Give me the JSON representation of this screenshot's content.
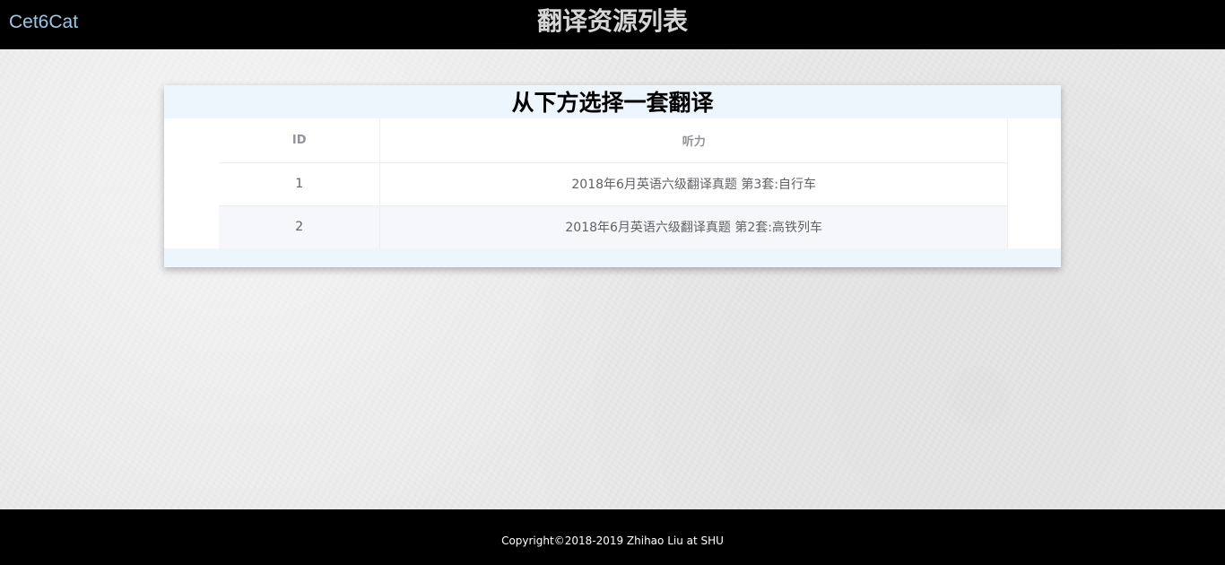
{
  "header": {
    "brand": "Cet6Cat",
    "title": "翻译资源列表"
  },
  "panel": {
    "heading": "从下方选择一套翻译",
    "columns": [
      "ID",
      "听力"
    ],
    "rows": [
      {
        "id": "1",
        "title": "2018年6月英语六级翻译真题 第3套:自行车"
      },
      {
        "id": "2",
        "title": "2018年6月英语六级翻译真题 第2套:高铁列车"
      }
    ]
  },
  "footer": {
    "copyright": "Copyright©2018-2019 Zhihao Liu at SHU"
  },
  "colors": {
    "topbar": "#000000",
    "brand": "#9cc7e6",
    "panel_header_bg": "#eef6fd",
    "striped_row": "#f5f7fa"
  }
}
